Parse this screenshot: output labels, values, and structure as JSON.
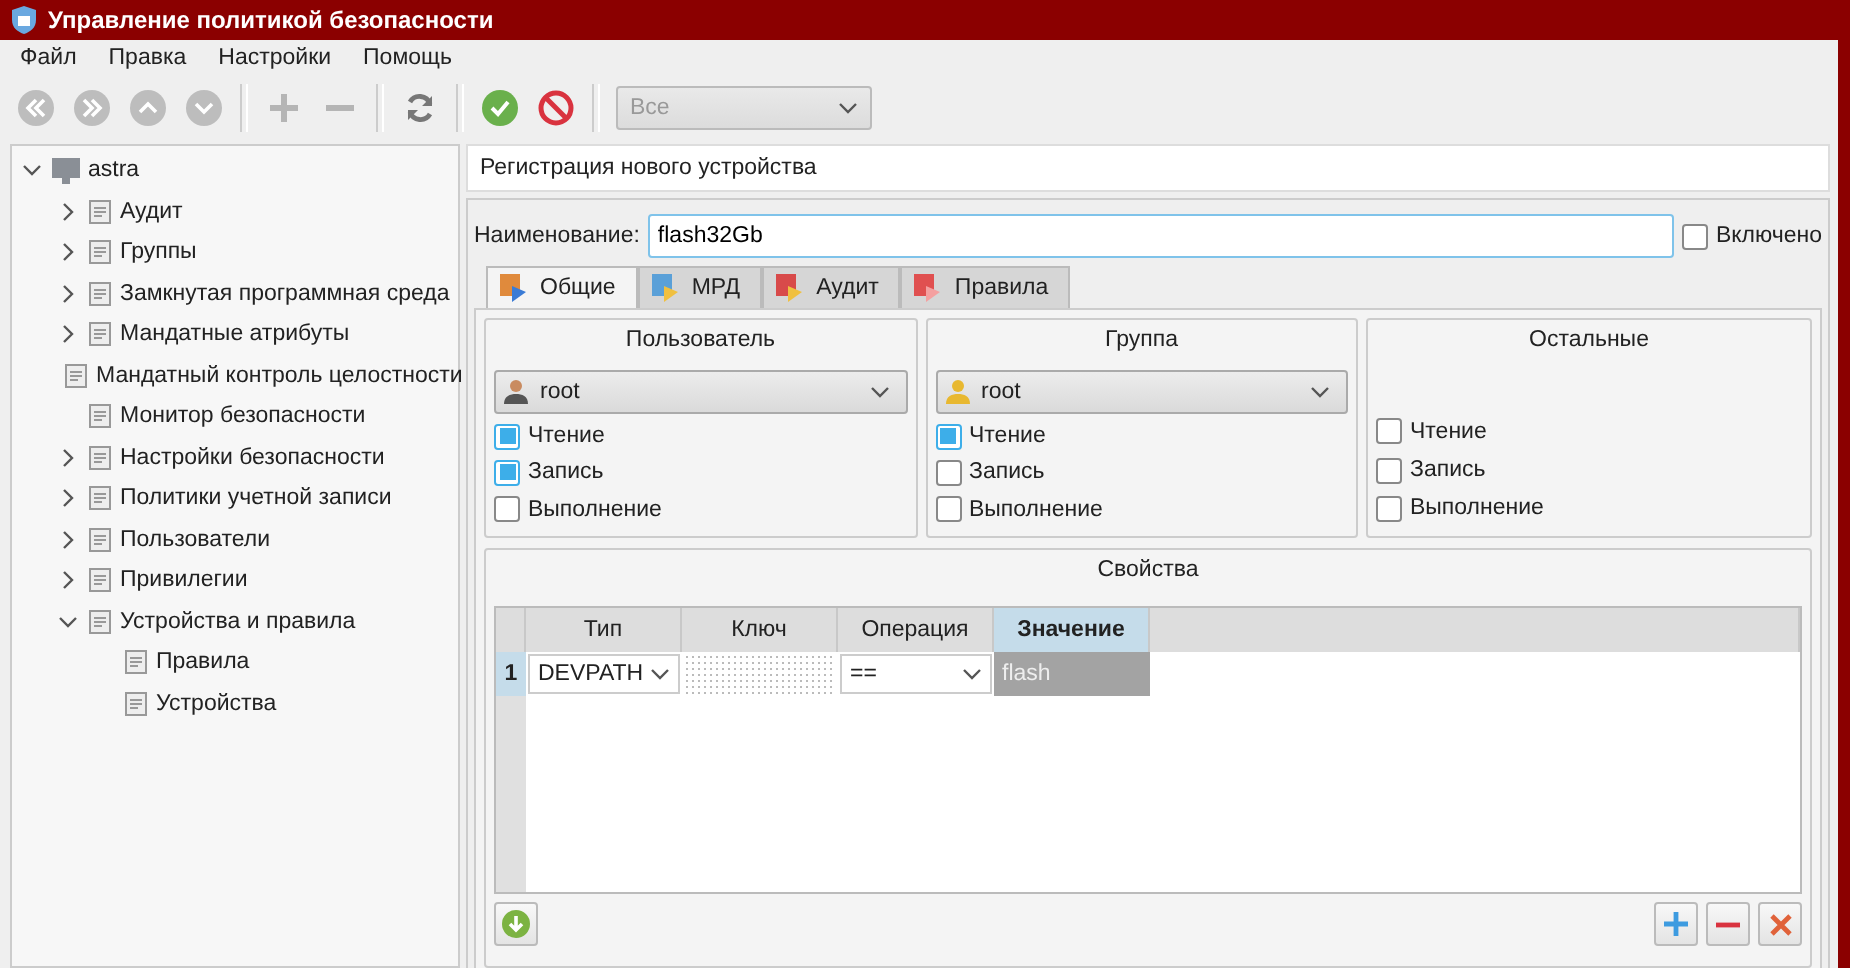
{
  "window": {
    "title": "Управление политикой безопасности"
  },
  "menu": [
    "Файл",
    "Правка",
    "Настройки",
    "Помощь"
  ],
  "toolbar": {
    "filter": "Все"
  },
  "tree": {
    "label": "astra",
    "expanded": true,
    "children": [
      {
        "label": "Аудит",
        "expanded": false
      },
      {
        "label": "Группы",
        "expanded": false
      },
      {
        "label": "Замкнутая программная среда",
        "expanded": false
      },
      {
        "label": "Мандатные атрибуты",
        "expanded": false
      },
      {
        "label": "Мандатный контроль целостности"
      },
      {
        "label": "Монитор безопасности"
      },
      {
        "label": "Настройки безопасности",
        "expanded": false
      },
      {
        "label": "Политики учетной записи",
        "expanded": false
      },
      {
        "label": "Пользователи",
        "expanded": false
      },
      {
        "label": "Привилегии",
        "expanded": false
      },
      {
        "label": "Устройства и правила",
        "expanded": true,
        "children": [
          {
            "label": "Правила"
          },
          {
            "label": "Устройства"
          }
        ]
      }
    ]
  },
  "panel_title": "Регистрация нового устройства",
  "name_label": "Наименование:",
  "name_value": "flash32Gb",
  "enabled": {
    "label": "Включено",
    "checked": false
  },
  "tabs": [
    {
      "label": "Общие",
      "selected": true
    },
    {
      "label": "МРД",
      "selected": false
    },
    {
      "label": "Аудит",
      "selected": false
    },
    {
      "label": "Правила",
      "selected": false
    }
  ],
  "access": [
    {
      "title": "Пользователь",
      "kind": "combo",
      "value": "root",
      "checks": [
        {
          "label": "Чтение",
          "checked": true
        },
        {
          "label": "Запись",
          "checked": true
        },
        {
          "label": "Выполнение",
          "checked": false
        }
      ]
    },
    {
      "title": "Группа",
      "kind": "combo",
      "value": "root",
      "checks": [
        {
          "label": "Чтение",
          "checked": true
        },
        {
          "label": "Запись",
          "checked": false
        },
        {
          "label": "Выполнение",
          "checked": false
        }
      ]
    },
    {
      "title": "Остальные",
      "kind": "plain",
      "checks": [
        {
          "label": "Чтение",
          "checked": false
        },
        {
          "label": "Запись",
          "checked": false
        },
        {
          "label": "Выполнение",
          "checked": false
        }
      ]
    }
  ],
  "properties": {
    "title": "Свойства",
    "columns": [
      {
        "label": "Тип",
        "selected": false
      },
      {
        "label": "Ключ",
        "selected": false
      },
      {
        "label": "Операция",
        "selected": false
      },
      {
        "label": "Значение",
        "selected": true
      }
    ],
    "rows": [
      {
        "number": "1",
        "type": "DEVPATH",
        "operation": "==",
        "value": "flash"
      }
    ]
  }
}
